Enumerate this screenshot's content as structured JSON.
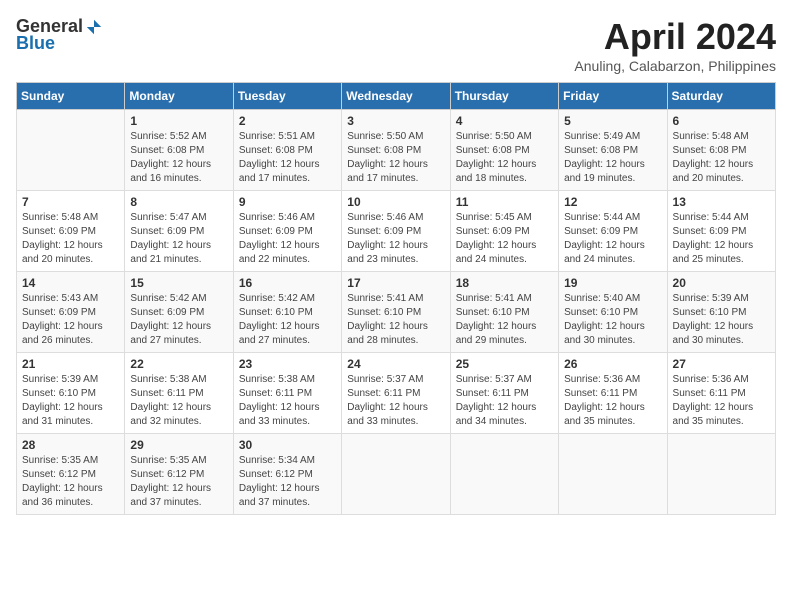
{
  "logo": {
    "general": "General",
    "blue": "Blue"
  },
  "title": "April 2024",
  "subtitle": "Anuling, Calabarzon, Philippines",
  "days_header": [
    "Sunday",
    "Monday",
    "Tuesday",
    "Wednesday",
    "Thursday",
    "Friday",
    "Saturday"
  ],
  "weeks": [
    [
      {
        "day": "",
        "sunrise": "",
        "sunset": "",
        "daylight": ""
      },
      {
        "day": "1",
        "sunrise": "Sunrise: 5:52 AM",
        "sunset": "Sunset: 6:08 PM",
        "daylight": "Daylight: 12 hours and 16 minutes."
      },
      {
        "day": "2",
        "sunrise": "Sunrise: 5:51 AM",
        "sunset": "Sunset: 6:08 PM",
        "daylight": "Daylight: 12 hours and 17 minutes."
      },
      {
        "day": "3",
        "sunrise": "Sunrise: 5:50 AM",
        "sunset": "Sunset: 6:08 PM",
        "daylight": "Daylight: 12 hours and 17 minutes."
      },
      {
        "day": "4",
        "sunrise": "Sunrise: 5:50 AM",
        "sunset": "Sunset: 6:08 PM",
        "daylight": "Daylight: 12 hours and 18 minutes."
      },
      {
        "day": "5",
        "sunrise": "Sunrise: 5:49 AM",
        "sunset": "Sunset: 6:08 PM",
        "daylight": "Daylight: 12 hours and 19 minutes."
      },
      {
        "day": "6",
        "sunrise": "Sunrise: 5:48 AM",
        "sunset": "Sunset: 6:08 PM",
        "daylight": "Daylight: 12 hours and 20 minutes."
      }
    ],
    [
      {
        "day": "7",
        "sunrise": "Sunrise: 5:48 AM",
        "sunset": "Sunset: 6:09 PM",
        "daylight": "Daylight: 12 hours and 20 minutes."
      },
      {
        "day": "8",
        "sunrise": "Sunrise: 5:47 AM",
        "sunset": "Sunset: 6:09 PM",
        "daylight": "Daylight: 12 hours and 21 minutes."
      },
      {
        "day": "9",
        "sunrise": "Sunrise: 5:46 AM",
        "sunset": "Sunset: 6:09 PM",
        "daylight": "Daylight: 12 hours and 22 minutes."
      },
      {
        "day": "10",
        "sunrise": "Sunrise: 5:46 AM",
        "sunset": "Sunset: 6:09 PM",
        "daylight": "Daylight: 12 hours and 23 minutes."
      },
      {
        "day": "11",
        "sunrise": "Sunrise: 5:45 AM",
        "sunset": "Sunset: 6:09 PM",
        "daylight": "Daylight: 12 hours and 24 minutes."
      },
      {
        "day": "12",
        "sunrise": "Sunrise: 5:44 AM",
        "sunset": "Sunset: 6:09 PM",
        "daylight": "Daylight: 12 hours and 24 minutes."
      },
      {
        "day": "13",
        "sunrise": "Sunrise: 5:44 AM",
        "sunset": "Sunset: 6:09 PM",
        "daylight": "Daylight: 12 hours and 25 minutes."
      }
    ],
    [
      {
        "day": "14",
        "sunrise": "Sunrise: 5:43 AM",
        "sunset": "Sunset: 6:09 PM",
        "daylight": "Daylight: 12 hours and 26 minutes."
      },
      {
        "day": "15",
        "sunrise": "Sunrise: 5:42 AM",
        "sunset": "Sunset: 6:09 PM",
        "daylight": "Daylight: 12 hours and 27 minutes."
      },
      {
        "day": "16",
        "sunrise": "Sunrise: 5:42 AM",
        "sunset": "Sunset: 6:10 PM",
        "daylight": "Daylight: 12 hours and 27 minutes."
      },
      {
        "day": "17",
        "sunrise": "Sunrise: 5:41 AM",
        "sunset": "Sunset: 6:10 PM",
        "daylight": "Daylight: 12 hours and 28 minutes."
      },
      {
        "day": "18",
        "sunrise": "Sunrise: 5:41 AM",
        "sunset": "Sunset: 6:10 PM",
        "daylight": "Daylight: 12 hours and 29 minutes."
      },
      {
        "day": "19",
        "sunrise": "Sunrise: 5:40 AM",
        "sunset": "Sunset: 6:10 PM",
        "daylight": "Daylight: 12 hours and 30 minutes."
      },
      {
        "day": "20",
        "sunrise": "Sunrise: 5:39 AM",
        "sunset": "Sunset: 6:10 PM",
        "daylight": "Daylight: 12 hours and 30 minutes."
      }
    ],
    [
      {
        "day": "21",
        "sunrise": "Sunrise: 5:39 AM",
        "sunset": "Sunset: 6:10 PM",
        "daylight": "Daylight: 12 hours and 31 minutes."
      },
      {
        "day": "22",
        "sunrise": "Sunrise: 5:38 AM",
        "sunset": "Sunset: 6:11 PM",
        "daylight": "Daylight: 12 hours and 32 minutes."
      },
      {
        "day": "23",
        "sunrise": "Sunrise: 5:38 AM",
        "sunset": "Sunset: 6:11 PM",
        "daylight": "Daylight: 12 hours and 33 minutes."
      },
      {
        "day": "24",
        "sunrise": "Sunrise: 5:37 AM",
        "sunset": "Sunset: 6:11 PM",
        "daylight": "Daylight: 12 hours and 33 minutes."
      },
      {
        "day": "25",
        "sunrise": "Sunrise: 5:37 AM",
        "sunset": "Sunset: 6:11 PM",
        "daylight": "Daylight: 12 hours and 34 minutes."
      },
      {
        "day": "26",
        "sunrise": "Sunrise: 5:36 AM",
        "sunset": "Sunset: 6:11 PM",
        "daylight": "Daylight: 12 hours and 35 minutes."
      },
      {
        "day": "27",
        "sunrise": "Sunrise: 5:36 AM",
        "sunset": "Sunset: 6:11 PM",
        "daylight": "Daylight: 12 hours and 35 minutes."
      }
    ],
    [
      {
        "day": "28",
        "sunrise": "Sunrise: 5:35 AM",
        "sunset": "Sunset: 6:12 PM",
        "daylight": "Daylight: 12 hours and 36 minutes."
      },
      {
        "day": "29",
        "sunrise": "Sunrise: 5:35 AM",
        "sunset": "Sunset: 6:12 PM",
        "daylight": "Daylight: 12 hours and 37 minutes."
      },
      {
        "day": "30",
        "sunrise": "Sunrise: 5:34 AM",
        "sunset": "Sunset: 6:12 PM",
        "daylight": "Daylight: 12 hours and 37 minutes."
      },
      {
        "day": "",
        "sunrise": "",
        "sunset": "",
        "daylight": ""
      },
      {
        "day": "",
        "sunrise": "",
        "sunset": "",
        "daylight": ""
      },
      {
        "day": "",
        "sunrise": "",
        "sunset": "",
        "daylight": ""
      },
      {
        "day": "",
        "sunrise": "",
        "sunset": "",
        "daylight": ""
      }
    ]
  ]
}
